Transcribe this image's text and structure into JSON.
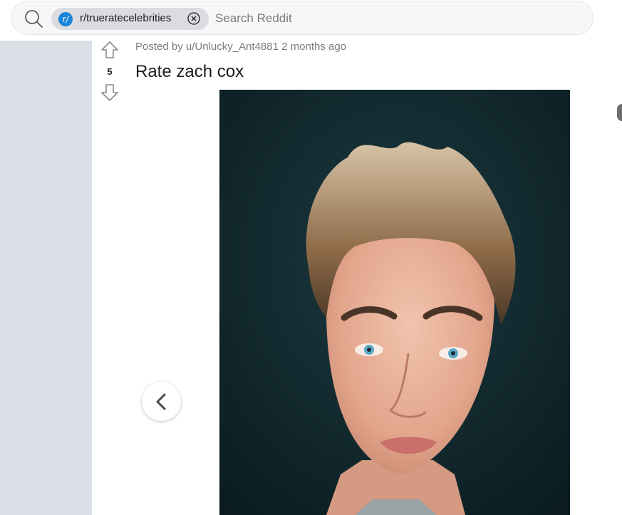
{
  "search": {
    "community_chip": "r/trueratecelebrities",
    "community_icon": "r/",
    "placeholder": "Search Reddit"
  },
  "post": {
    "score": "5",
    "meta": "Posted by u/Unlucky_Ant4881 2 months ago",
    "title": "Rate zach cox"
  },
  "icons": {
    "search": "search-icon",
    "chip_close": "close-circle-icon",
    "upvote": "arrow-up-icon",
    "downvote": "arrow-down-icon",
    "prev": "chevron-left-icon"
  },
  "colors": {
    "accent": "#1a84d8",
    "gutter": "#dae0e6",
    "meta_text": "#787c7e"
  }
}
